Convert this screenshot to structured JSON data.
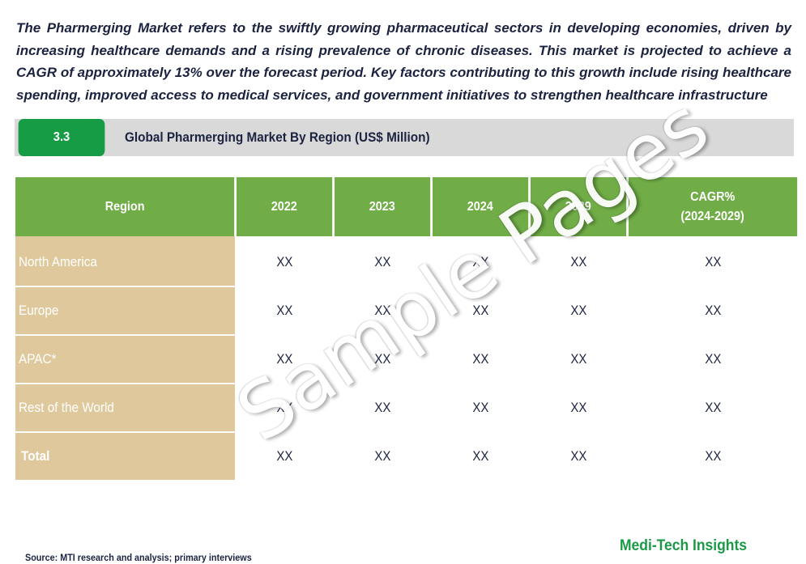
{
  "intro": {
    "text": "The Pharmerging Market refers to the swiftly growing pharmaceutical sectors in developing economies, driven by increasing healthcare demands and a rising prevalence of chronic diseases. This market is projected to achieve a CAGR of approximately 13% over the forecast period. Key factors contributing to this growth include rising healthcare spending, improved access to medical services, and government initiatives to strengthen healthcare infrastructure"
  },
  "section": {
    "number": "3.3",
    "title": "Global Pharmerging Market By Region (US$ Million)"
  },
  "table": {
    "headers": [
      "Region",
      "2022",
      "2023",
      "2024",
      "2029",
      "CAGR%",
      "(2024-2029)"
    ],
    "rows": [
      {
        "region": "North America",
        "values": [
          "XX",
          "XX",
          "XX",
          "XX",
          "XX"
        ]
      },
      {
        "region": "Europe",
        "values": [
          "XX",
          "XX",
          "XX",
          "XX",
          "XX"
        ]
      },
      {
        "region": "APAC*",
        "values": [
          "XX",
          "XX",
          "XX",
          "XX",
          "XX"
        ]
      },
      {
        "region": "Rest of the World",
        "values": [
          "XX",
          "XX",
          "XX",
          "XX",
          "XX"
        ]
      },
      {
        "region": "Total",
        "values": [
          "XX",
          "XX",
          "XX",
          "XX",
          "XX"
        ]
      }
    ]
  },
  "watermark": "Sample Pages",
  "footer": {
    "source": "Source: MTI research and analysis; primary interviews",
    "brand": "Medi-Tech Insights"
  },
  "colors": {
    "header_green": "#70ad47",
    "section_green": "#179c46",
    "region_beige": "#dfc99c",
    "section_bar_gray": "#d9d9d9",
    "brand_green": "#1a9a46",
    "text_navy": "#1c2340"
  }
}
